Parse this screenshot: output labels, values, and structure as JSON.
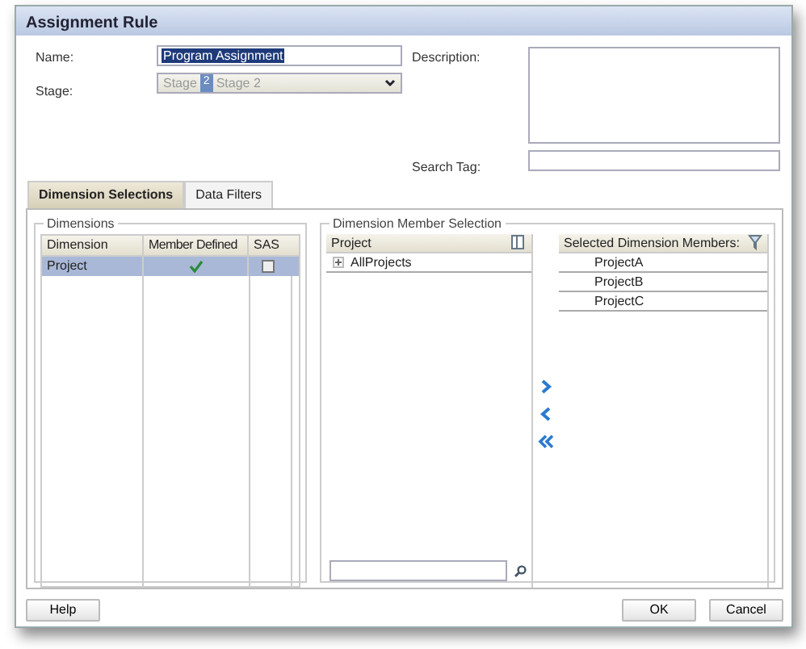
{
  "window": {
    "title": "Assignment Rule"
  },
  "form": {
    "name_label": "Name:",
    "name_value": "Program Assignment",
    "stage_label": "Stage:",
    "stage": {
      "prefix": "Stage",
      "number": "2",
      "value": "Stage 2"
    },
    "description_label": "Description:",
    "search_tag_label": "Search Tag:"
  },
  "tabs": [
    {
      "label": "Dimension Selections",
      "selected": true
    },
    {
      "label": "Data Filters",
      "selected": false
    }
  ],
  "dimensions": {
    "legend": "Dimensions",
    "columns": [
      "Dimension",
      "Member Defined",
      "SAS"
    ],
    "rows": [
      {
        "dimension": "Project",
        "member_defined": true,
        "sas": false,
        "selected": true
      }
    ]
  },
  "member_selection": {
    "legend": "Dimension Member Selection",
    "tree_header": "Project",
    "tree": [
      {
        "label": "AllProjects",
        "expanded": false
      }
    ],
    "selected_header": "Selected Dimension Members:",
    "selected_members": [
      "ProjectA",
      "ProjectB",
      "ProjectC"
    ]
  },
  "buttons": {
    "help": "Help",
    "ok": "OK",
    "cancel": "Cancel"
  }
}
